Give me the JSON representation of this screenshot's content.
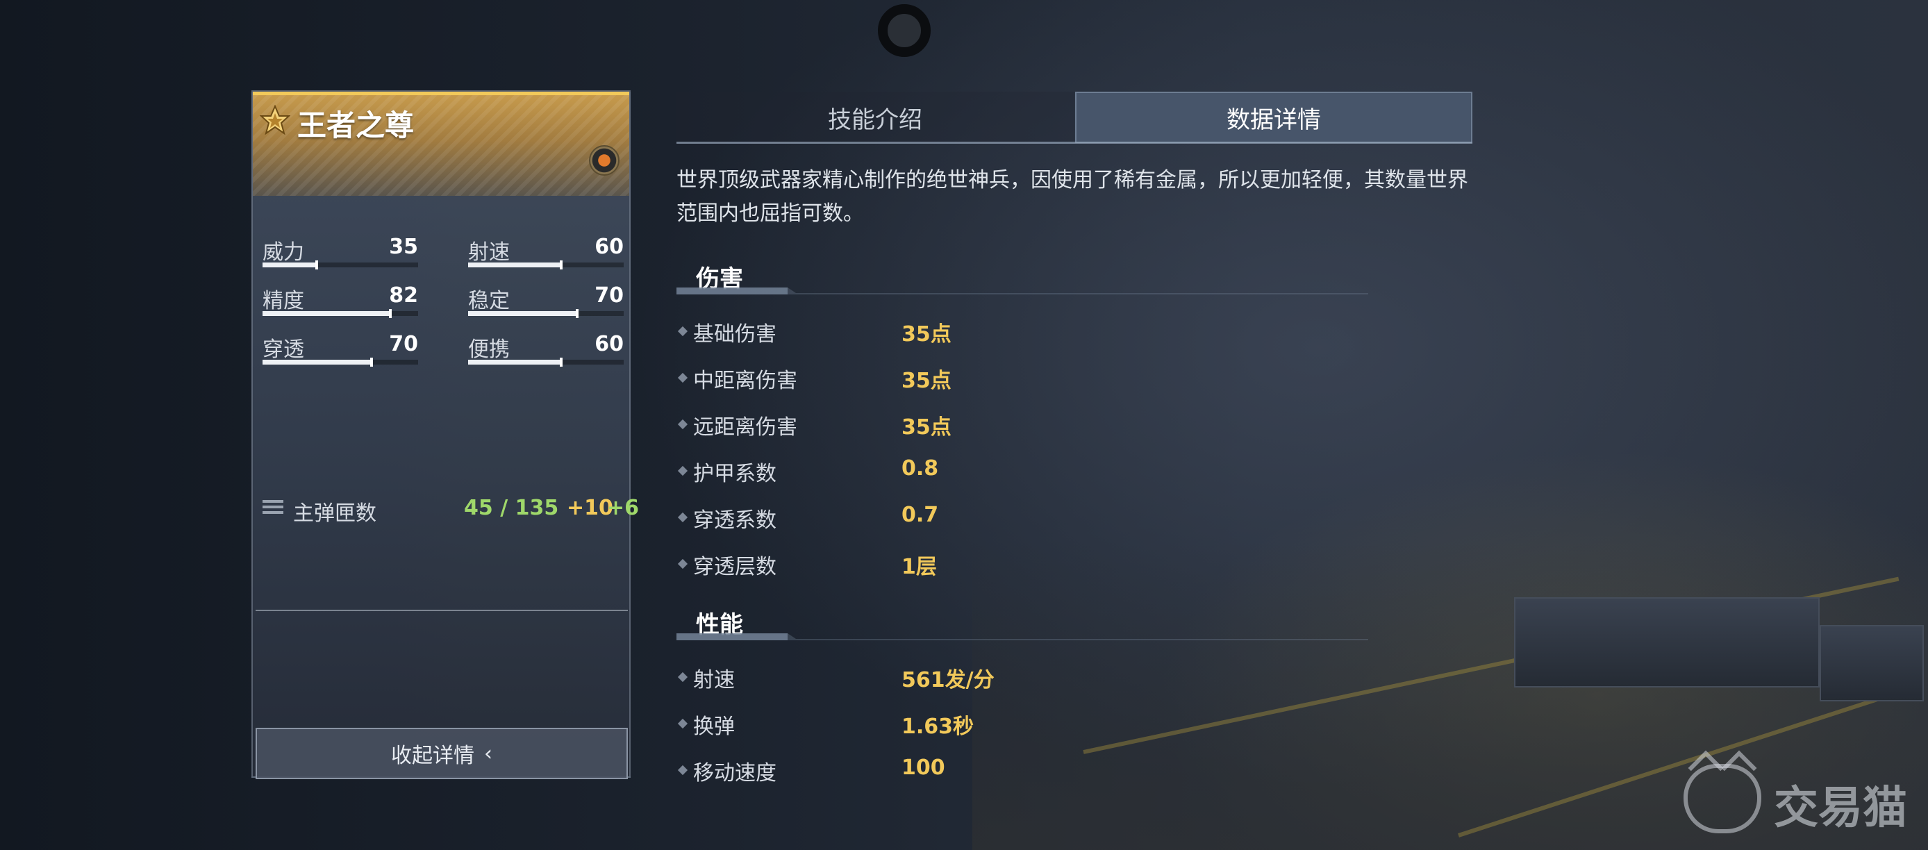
{
  "card": {
    "weapon_name": "王者之尊",
    "stats": [
      {
        "label": "威力",
        "value": "35",
        "level": 0.35
      },
      {
        "label": "射速",
        "value": "60",
        "level": 0.6
      },
      {
        "label": "精度",
        "value": "82",
        "level": 0.82
      },
      {
        "label": "稳定",
        "value": "70",
        "level": 0.7
      },
      {
        "label": "穿透",
        "value": "70",
        "level": 0.7
      },
      {
        "label": "便携",
        "value": "60",
        "level": 0.6
      }
    ],
    "ammo": {
      "label": "主弹匣数",
      "count": "45 / 135",
      "bonus_gold": "+10",
      "bonus_green": "+6"
    },
    "collapse_label": "收起详情",
    "collapse_icon": "chevron-left-icon"
  },
  "tabs": [
    {
      "label": "技能介绍",
      "active": false
    },
    {
      "label": "数据详情",
      "active": true
    }
  ],
  "description": "世界顶级武器家精心制作的绝世神兵，因使用了稀有金属，所以更加轻便，其数量世界范围内也屈指可数。",
  "sections": [
    {
      "title": "伤害",
      "rows": [
        {
          "label": "基础伤害",
          "value": "35点"
        },
        {
          "label": "中距离伤害",
          "value": "35点"
        },
        {
          "label": "远距离伤害",
          "value": "35点"
        },
        {
          "label": "护甲系数",
          "value": "0.8"
        },
        {
          "label": "穿透系数",
          "value": "0.7"
        },
        {
          "label": "穿透层数",
          "value": "1层"
        }
      ]
    },
    {
      "title": "性能",
      "rows": [
        {
          "label": "射速",
          "value": "561发/分"
        },
        {
          "label": "换弹",
          "value": "1.63秒"
        },
        {
          "label": "移动速度",
          "value": "100"
        }
      ]
    }
  ],
  "watermark": {
    "text": "交易猫"
  },
  "colors": {
    "gold": "#f2c95a",
    "green": "#9fd86a",
    "active_tab": "#47556a"
  }
}
